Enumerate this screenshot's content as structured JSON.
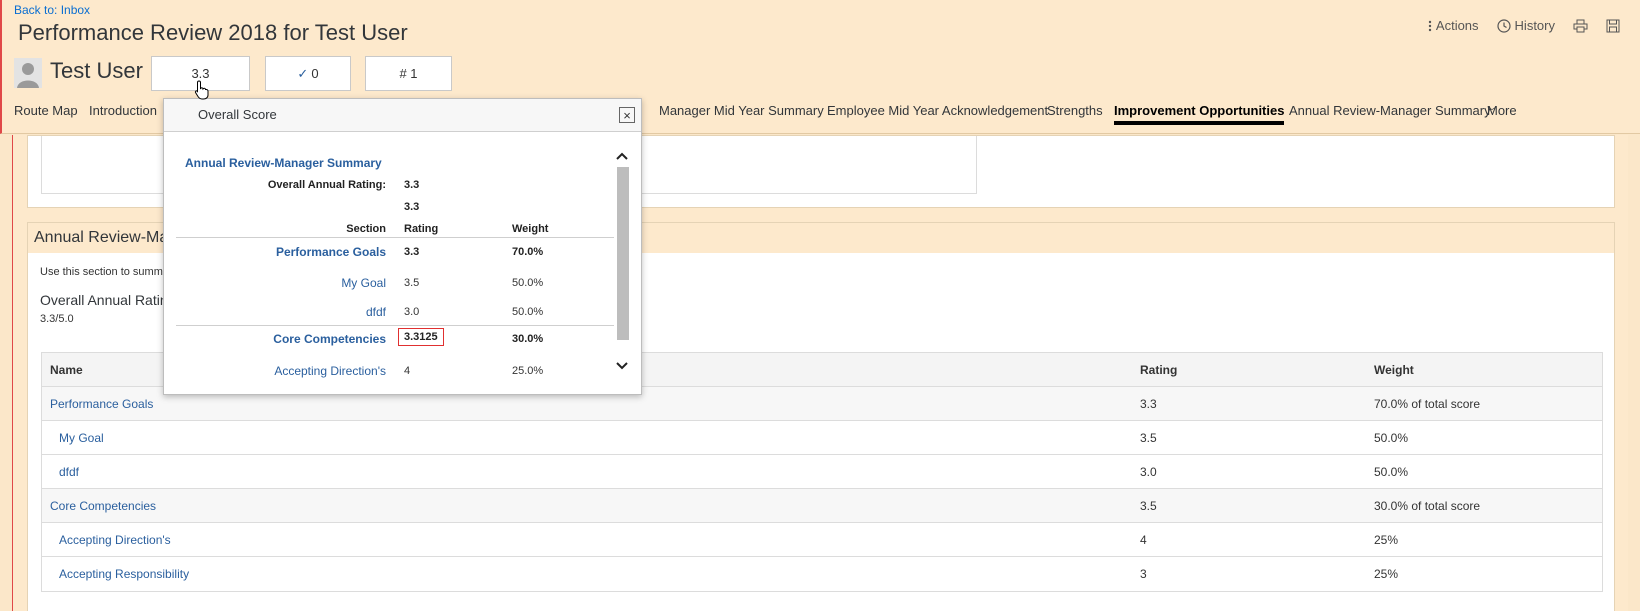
{
  "header": {
    "back_link": "Back to: Inbox",
    "title": "Performance Review 2018 for Test User",
    "actions_label": "Actions",
    "history_label": "History",
    "user_name": "Test User",
    "score_box": "3.3",
    "check_box": "0",
    "check_icon": "check-icon",
    "rank_box": "# 1"
  },
  "nav": {
    "tabs": [
      {
        "label": "Route Map"
      },
      {
        "label": "Introduction"
      },
      {
        "label": "Manager Mid Year Summary"
      },
      {
        "label": "Employee Mid Year Acknowledgement"
      },
      {
        "label": "Strengths"
      },
      {
        "label": "Improvement Opportunities"
      },
      {
        "label": "Annual Review-Manager Summary"
      },
      {
        "label": "More"
      }
    ],
    "active_index": 5
  },
  "section": {
    "title": "Annual Review-Ma",
    "description": "Use this section to summ",
    "overall_label": "Overall Annual Ratin",
    "overall_value": "3.3/5.0"
  },
  "table": {
    "headers": {
      "name": "Name",
      "rating": "Rating",
      "weight": "Weight"
    },
    "rows": [
      {
        "name": "Performance Goals",
        "rating": "3.3",
        "weight": "70.0% of total score"
      },
      {
        "name": "My Goal",
        "rating": "3.5",
        "weight": "50.0%"
      },
      {
        "name": "dfdf",
        "rating": "3.0",
        "weight": "50.0%"
      },
      {
        "name": "Core Competencies",
        "rating": "3.5",
        "weight": "30.0% of total score"
      },
      {
        "name": "Accepting Direction's",
        "rating": "4",
        "weight": "25%"
      },
      {
        "name": "Accepting Responsibility",
        "rating": "3",
        "weight": "25%"
      }
    ]
  },
  "popover": {
    "title": "Overall Score",
    "close": "×",
    "section": "Annual Review-Manager Summary",
    "overall_label": "Overall Annual Rating:",
    "overall_value": "3.3",
    "overall_value2": "3.3",
    "col_section": "Section",
    "col_rating": "Rating",
    "col_weight": "Weight",
    "rows": [
      {
        "name": "Performance Goals",
        "rating": "3.3",
        "weight": "70.0%"
      },
      {
        "name": "My Goal",
        "rating": "3.5",
        "weight": "50.0%"
      },
      {
        "name": "dfdf",
        "rating": "3.0",
        "weight": "50.0%"
      },
      {
        "name": "Core Competencies",
        "rating": "3.3125",
        "weight": "30.0%"
      },
      {
        "name": "Accepting Direction's",
        "rating": "4",
        "weight": "25.0%"
      }
    ]
  }
}
